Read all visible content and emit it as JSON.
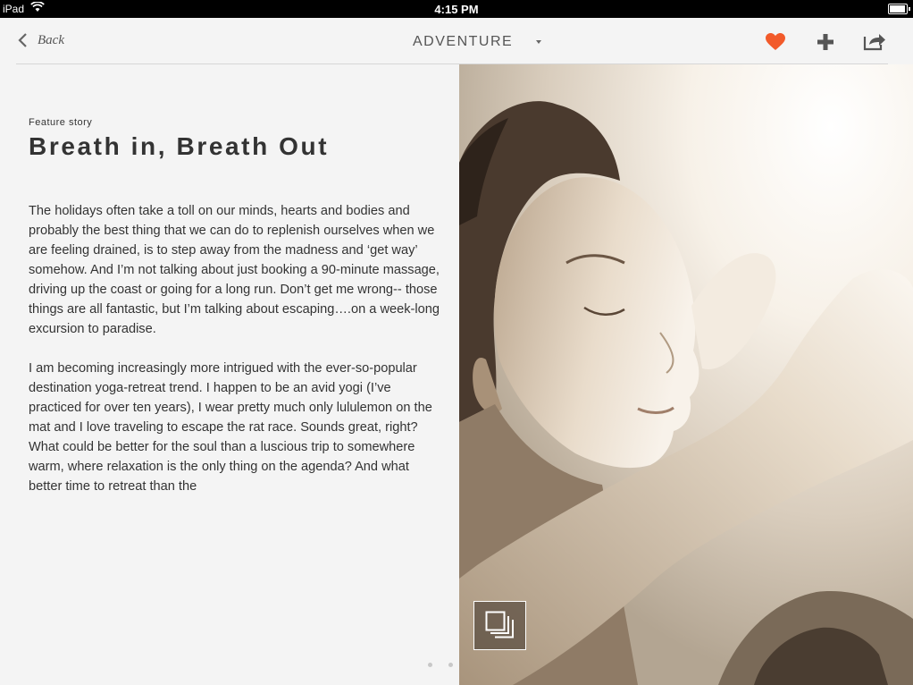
{
  "status_bar": {
    "device": "iPad",
    "time": "4:15 PM"
  },
  "nav": {
    "back_label": "Back",
    "section": "ADVENTURE",
    "icons": [
      "back-chevron-icon",
      "heart-icon",
      "plus-icon",
      "share-icon",
      "caret-down-icon"
    ],
    "accent_color": "#f25a2a"
  },
  "article": {
    "kicker": "Feature story",
    "title": "Breath in, Breath Out",
    "paragraphs": [
      "The holidays often take a toll on our minds, hearts and bodies and probably the best thing that we can do to replenish ourselves when we are feeling drained, is to step away from the madness and ‘get way’ somehow.  And I’m not talking about just booking a 90-minute massage, driving up the coast or going for a long run. Don’t get me wrong-- those things are all fantastic, but I’m talking about escaping….on a week-long excursion to paradise.",
      "I am becoming increasingly more intrigued with the ever-so-popular destination yoga-retreat trend. I happen to be an avid yogi (I’ve practiced for over ten years), I wear pretty much only lululemon on the mat and I love traveling to escape the rat race. Sounds great, right? What could be better for the soul than a luscious trip to somewhere warm, where relaxation is the only thing on the agenda? And what better time to retreat than the"
    ]
  },
  "pagination": {
    "count": 4,
    "active_index": 3,
    "active_color": "#d92b1c"
  },
  "photo": {
    "description_icon": "gallery-icon"
  }
}
